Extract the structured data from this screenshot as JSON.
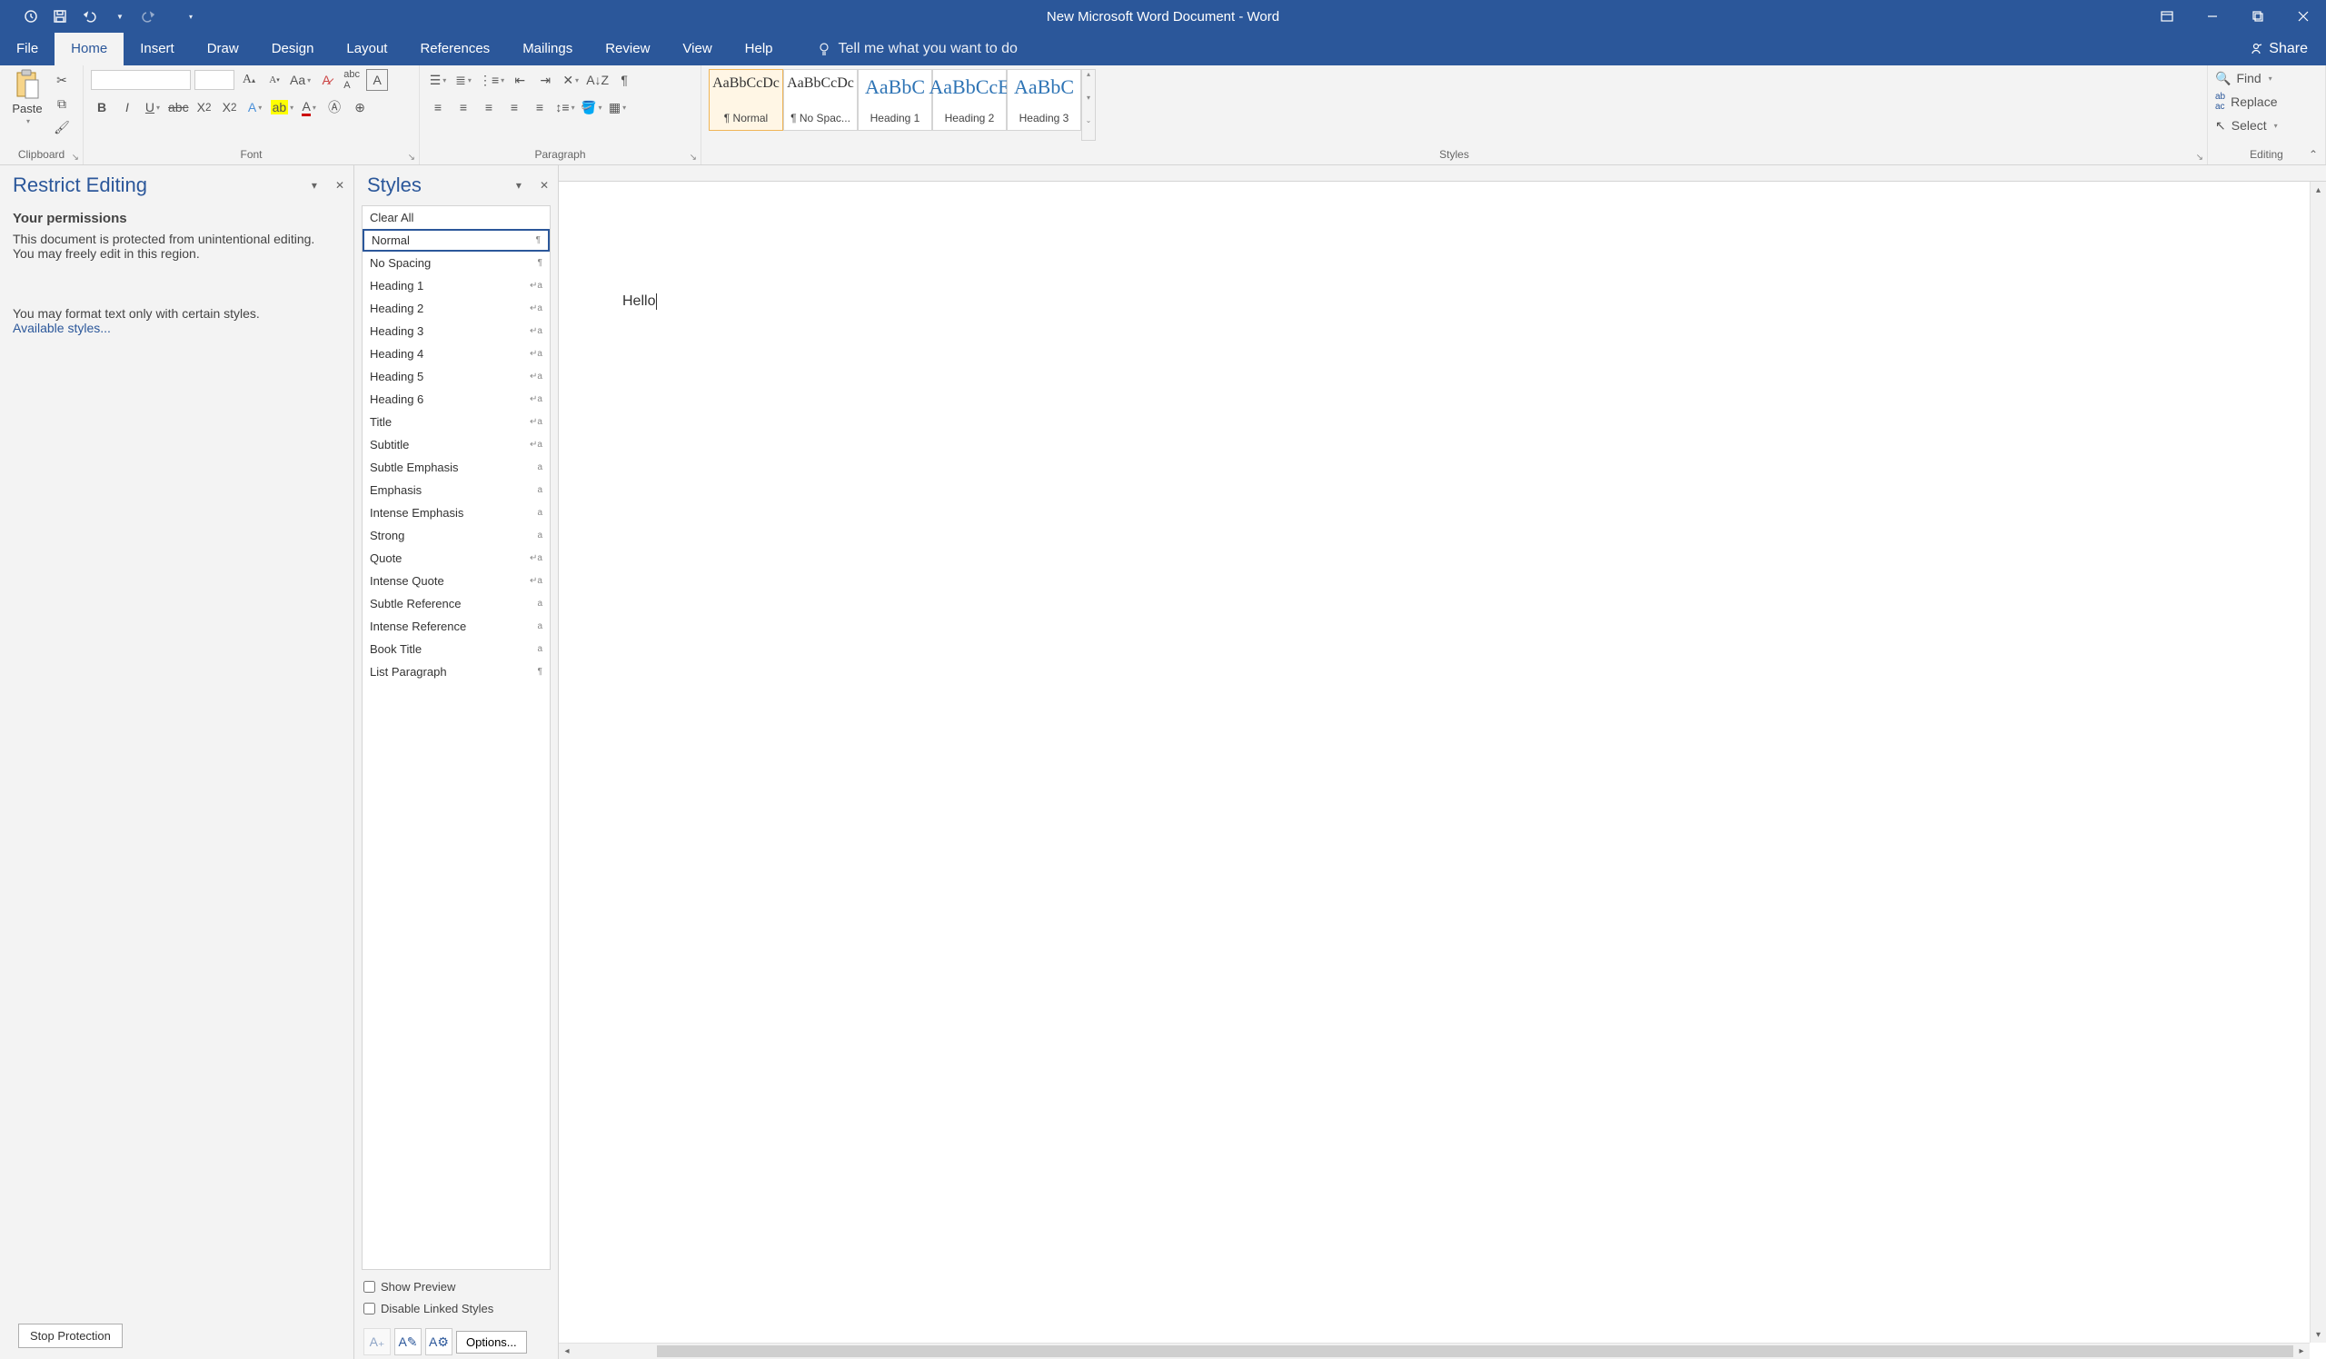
{
  "title": "New Microsoft Word Document  -  Word",
  "tabs": [
    "File",
    "Home",
    "Insert",
    "Draw",
    "Design",
    "Layout",
    "References",
    "Mailings",
    "Review",
    "View",
    "Help"
  ],
  "tellme": "Tell me what you want to do",
  "share": "Share",
  "ribbon": {
    "clipboard": {
      "paste": "Paste",
      "label": "Clipboard"
    },
    "font": {
      "label": "Font"
    },
    "paragraph": {
      "label": "Paragraph"
    },
    "styles": {
      "label": "Styles",
      "items": [
        {
          "preview": "AaBbCcDc",
          "name": "¶ Normal"
        },
        {
          "preview": "AaBbCcDc",
          "name": "¶ No Spac..."
        },
        {
          "preview": "AaBbC",
          "name": "Heading 1"
        },
        {
          "preview": "AaBbCcE",
          "name": "Heading 2"
        },
        {
          "preview": "AaBbC",
          "name": "Heading 3"
        }
      ]
    },
    "editing": {
      "label": "Editing",
      "find": "Find",
      "replace": "Replace",
      "select": "Select"
    }
  },
  "restrict": {
    "title": "Restrict Editing",
    "perm": "Your permissions",
    "line1": "This document is protected from unintentional editing.",
    "line2": "You may freely edit in this region.",
    "line3": "You may format text only with certain styles.",
    "avail": "Available styles...",
    "stop": "Stop Protection"
  },
  "stylesPane": {
    "title": "Styles",
    "items": [
      {
        "n": "Clear All",
        "m": ""
      },
      {
        "n": "Normal",
        "m": "¶"
      },
      {
        "n": "No Spacing",
        "m": "¶"
      },
      {
        "n": "Heading 1",
        "m": "↵a"
      },
      {
        "n": "Heading 2",
        "m": "↵a"
      },
      {
        "n": "Heading 3",
        "m": "↵a"
      },
      {
        "n": "Heading 4",
        "m": "↵a"
      },
      {
        "n": "Heading 5",
        "m": "↵a"
      },
      {
        "n": "Heading 6",
        "m": "↵a"
      },
      {
        "n": "Title",
        "m": "↵a"
      },
      {
        "n": "Subtitle",
        "m": "↵a"
      },
      {
        "n": "Subtle Emphasis",
        "m": "a"
      },
      {
        "n": "Emphasis",
        "m": "a"
      },
      {
        "n": "Intense Emphasis",
        "m": "a"
      },
      {
        "n": "Strong",
        "m": "a"
      },
      {
        "n": "Quote",
        "m": "↵a"
      },
      {
        "n": "Intense Quote",
        "m": "↵a"
      },
      {
        "n": "Subtle Reference",
        "m": "a"
      },
      {
        "n": "Intense Reference",
        "m": "a"
      },
      {
        "n": "Book Title",
        "m": "a"
      },
      {
        "n": "List Paragraph",
        "m": "¶"
      }
    ],
    "showPreview": "Show Preview",
    "disableLinked": "Disable Linked Styles",
    "options": "Options..."
  },
  "docText": "Hello"
}
